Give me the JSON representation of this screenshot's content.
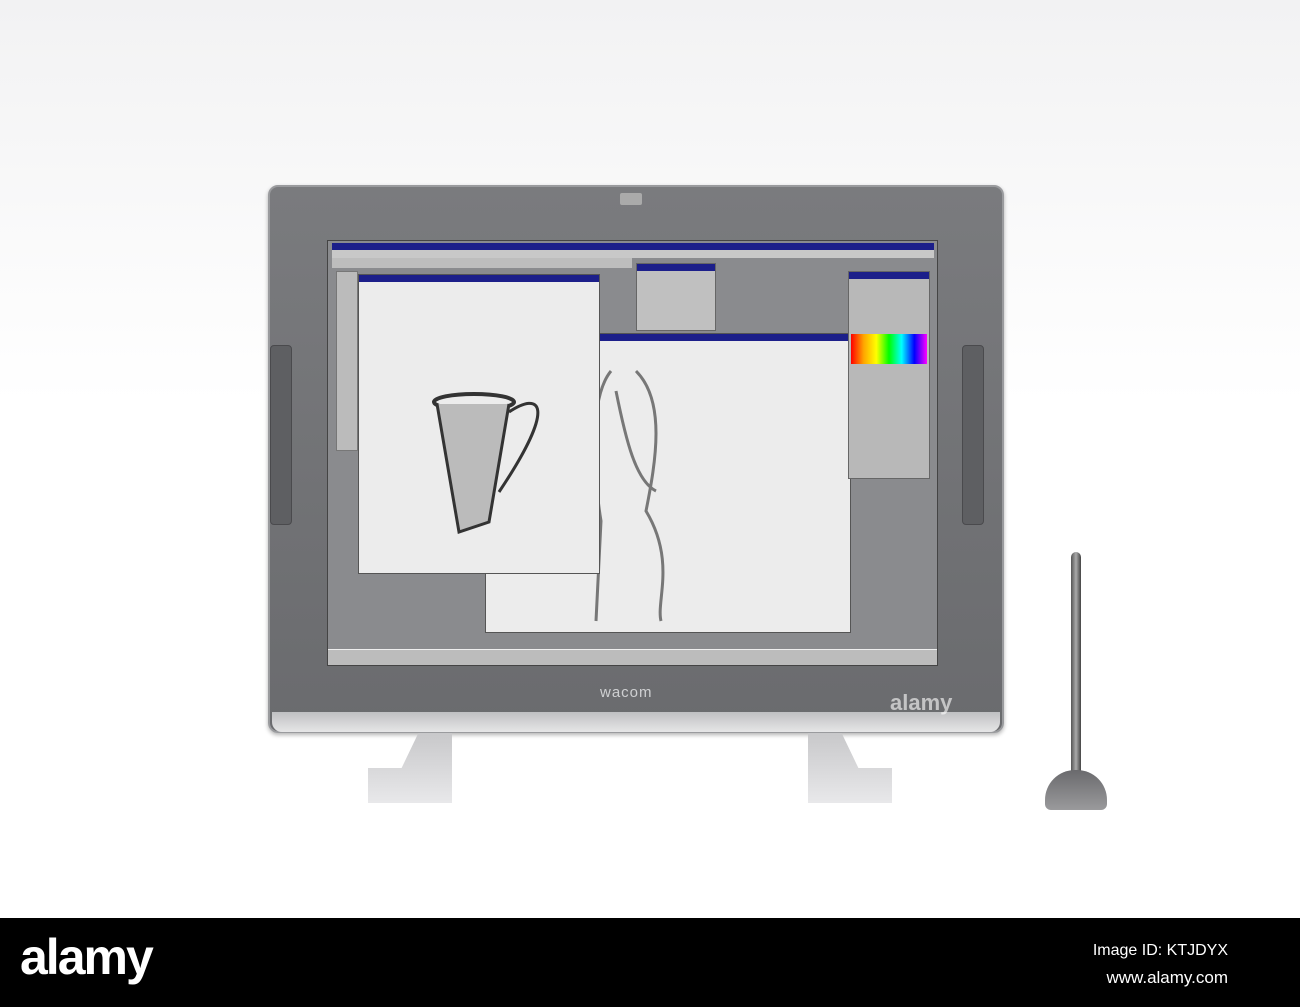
{
  "device": {
    "brand": "wacom",
    "screen": {
      "app": "photoshop-like editor",
      "colors": {
        "title_bar": "#1c1f8a",
        "desktop": "#8a8b8e"
      }
    }
  },
  "watermark": {
    "text": "alamy",
    "glyph": "a"
  },
  "footer": {
    "logo": "alamy",
    "image_id": "Image ID: KTJDYX",
    "url": "www.alamy.com"
  }
}
